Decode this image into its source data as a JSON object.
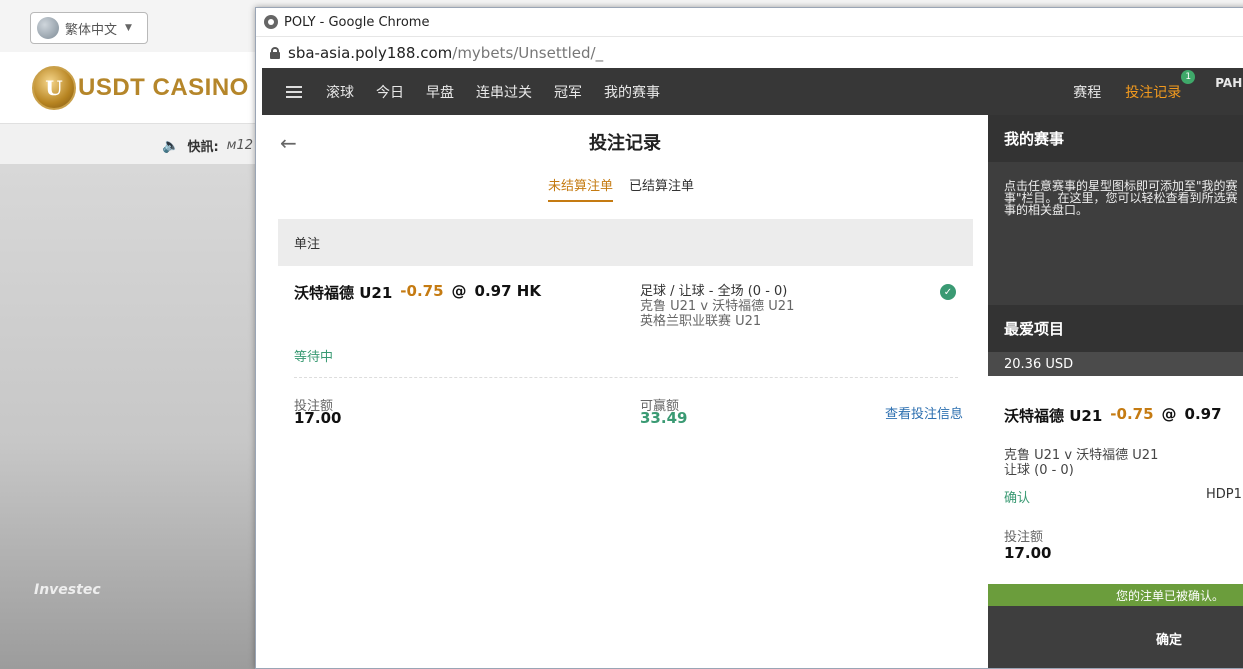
{
  "background": {
    "language": "繁体中文",
    "logo_mark": "U",
    "logo_text": "USDT CASINO",
    "news_label": "快訊:",
    "news_text": "м12",
    "stadium_text": "Investec"
  },
  "window": {
    "title": "POLY - Google Chrome",
    "url_host": "sba-asia.poly188.com",
    "url_path": "/mybets/Unsettled/_"
  },
  "nav": {
    "items": [
      "滚球",
      "今日",
      "早盘",
      "连串过关",
      "冠军",
      "我的赛事"
    ],
    "schedule": "赛程",
    "bet_record": "投注记录",
    "badge": "1",
    "user": "PAHU"
  },
  "main": {
    "title": "投注记录",
    "tabs": [
      {
        "label": "未结算注单",
        "active": true
      },
      {
        "label": "已结算注单",
        "active": false
      }
    ],
    "section": "单注",
    "bet": {
      "selection": "沃特福德 U21",
      "handicap": "-0.75",
      "at": "@",
      "odds": "0.97 HK",
      "market": "足球 / 让球 - 全场 (0 - 0)",
      "match": "克鲁 U21 v 沃特福德 U21",
      "league": "英格兰职业联赛 U21",
      "status": "等待中",
      "stake_label": "投注额",
      "stake": "17.00",
      "win_label": "可赢额",
      "win": "33.49",
      "view_info": "查看投注信息"
    }
  },
  "sidebar": {
    "my_events_title": "我的赛事",
    "my_events_desc": "点击任意赛事的星型图标即可添加至\"我的赛事\"栏目。在这里，您可以轻松查看到所选赛事的相关盘口。",
    "fav_title": "最爱项目",
    "fav_amount": "20.36 USD",
    "fav_selection": "沃特福德 U21",
    "fav_handicap": "-0.75",
    "fav_at": "@",
    "fav_odds": "0.97",
    "fav_match": "克鲁 U21 v 沃特福德 U21",
    "fav_market": "让球 (0 - 0)",
    "fav_confirm": "确认",
    "fav_hdp": "HDP1",
    "fav_stake_label": "投注额",
    "fav_stake": "17.00",
    "notice": "您的注单已被确认。",
    "ok_button": "确定"
  },
  "colors": {
    "accent_orange": "#c57b12",
    "nav_active": "#f29a1e",
    "green": "#3a9a73",
    "nav_bg": "#373737"
  }
}
